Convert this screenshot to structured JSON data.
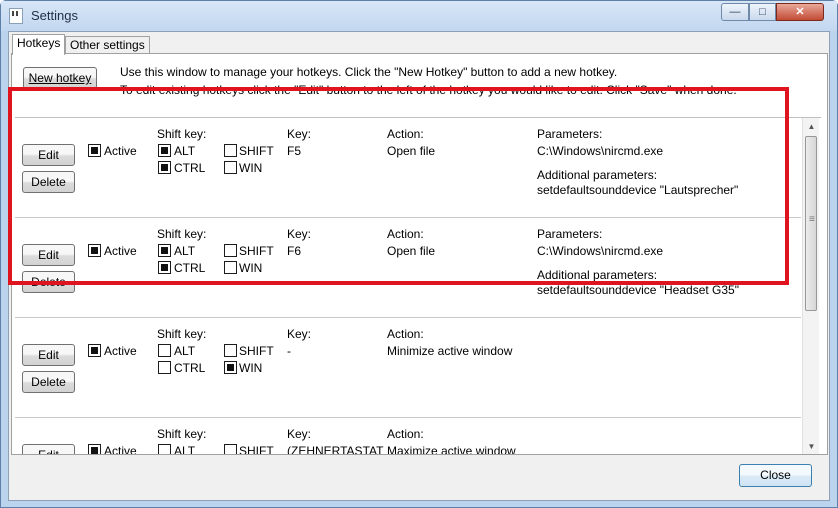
{
  "window": {
    "title": "Settings"
  },
  "tabs": [
    {
      "label": "Hotkeys",
      "active": true
    },
    {
      "label": "Other settings",
      "active": false
    }
  ],
  "toolbar": {
    "new_hotkey_label": "New hotkey",
    "info_line1": "Use this window to manage your hotkeys. Click the \"New Hotkey\" button to add a new hotkey.",
    "info_line2": "To edit existing hotkeys click the \"Edit\" button to the left of the hotkey you would like to edit. Click \"Save\" when done."
  },
  "labels": {
    "edit": "Edit",
    "delete": "Delete",
    "active": "Active",
    "shift_key": "Shift key:",
    "alt": "ALT",
    "ctrl": "CTRL",
    "shift": "SHIFT",
    "win": "WIN",
    "key": "Key:",
    "action": "Action:",
    "parameters": "Parameters:",
    "additional_parameters": "Additional parameters:"
  },
  "hotkeys": [
    {
      "active": true,
      "alt": true,
      "ctrl": true,
      "shift": false,
      "win": false,
      "key": "F5",
      "action": "Open file",
      "parameters": "C:\\Windows\\nircmd.exe",
      "additional_parameters": "setdefaultsounddevice \"Lautsprecher\""
    },
    {
      "active": true,
      "alt": true,
      "ctrl": true,
      "shift": false,
      "win": false,
      "key": "F6",
      "action": "Open file",
      "parameters": "C:\\Windows\\nircmd.exe",
      "additional_parameters": "setdefaultsounddevice \"Headset G35\""
    },
    {
      "active": true,
      "alt": false,
      "ctrl": false,
      "shift": false,
      "win": true,
      "key": "-",
      "action": "Minimize active window",
      "parameters": "",
      "additional_parameters": ""
    },
    {
      "active": true,
      "alt": false,
      "ctrl": false,
      "shift": false,
      "win": false,
      "key": " (ZEHNERTASTAT",
      "action": "Maximize active window",
      "parameters": "",
      "additional_parameters": ""
    }
  ],
  "footer": {
    "close_label": "Close"
  },
  "colors": {
    "highlight": "#e0141e",
    "titlebar": "#c2d7f0",
    "close_button": "#c24a34"
  }
}
